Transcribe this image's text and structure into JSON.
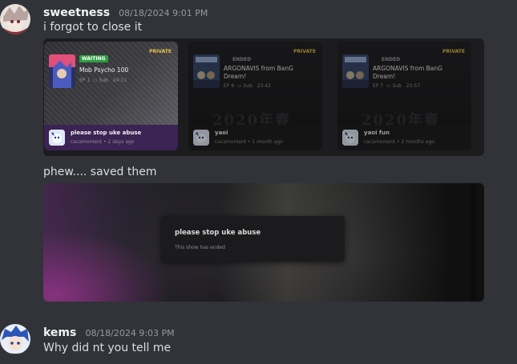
{
  "messages": [
    {
      "username": "sweetness",
      "timestamp": "08/18/2024 9:01 PM",
      "text": "i forgot to close it"
    },
    {
      "text": "phew.... saved them"
    },
    {
      "username": "kems",
      "timestamp": "08/18/2024 9:03 PM",
      "text": "Why did nt you tell me"
    }
  ],
  "cards": [
    {
      "status": "WAITING",
      "private": "PRIVATE",
      "title": "Mob Psycho 100",
      "ep": "EP 1",
      "sub": "Sub",
      "duration": "24:11",
      "room_title": "please stop uke abuse",
      "room_user": "cacamoment",
      "room_time": "2 days ago"
    },
    {
      "status": "ENDED",
      "private": "PRIVATE",
      "title": "ARGONAVIS from BanG Dream!",
      "ep": "EP 8",
      "sub": "Sub",
      "duration": "23:42",
      "watermark": "2020年春",
      "room_title": "yaoi",
      "room_user": "cacamoment",
      "room_time": "1 month ago"
    },
    {
      "status": "ENDED",
      "private": "PRIVATE",
      "title": "ARGONAVIS from BanG Dream!",
      "ep": "EP 7",
      "sub": "Sub",
      "duration": "23:57",
      "watermark": "2020年春",
      "room_title": "yaoi fun",
      "room_user": "cacamoment",
      "room_time": "2 months ago"
    }
  ],
  "dialog": {
    "title": "please stop uke abuse",
    "subtitle": "This show has ended"
  },
  "icons": {
    "subtitles": "subtitles-icon"
  },
  "colors": {
    "background": "#313338",
    "waiting_badge": "#2f9e44",
    "private_label": "#e6c34a",
    "active_card_footer": "#3b2353"
  }
}
